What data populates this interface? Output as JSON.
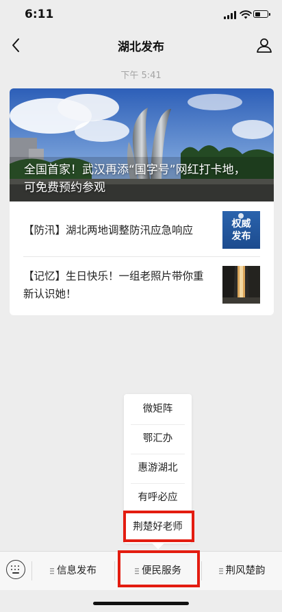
{
  "status_bar": {
    "time": "6:11",
    "battery_level": 0.35
  },
  "nav": {
    "title": "湖北发布",
    "back_icon": "chevron-left-icon",
    "profile_icon": "person-icon"
  },
  "chat": {
    "timestamp": "下午 5:41",
    "article": {
      "hero_title": "全国首家！武汉再添“国字号”网红打卡地，可免费预约参观",
      "items": [
        {
          "title": "【防汛】湖北两地调整防汛应急响应",
          "thumb_text_line1": "权威",
          "thumb_text_line2": "发布"
        },
        {
          "title": "【记忆】生日快乐！一组老照片带你重新认识她！"
        }
      ]
    }
  },
  "popup_menu": {
    "items": [
      "微矩阵",
      "鄂汇办",
      "惠游湖北",
      "有呼必应",
      "荆楚好老师"
    ]
  },
  "bottom_menu": {
    "keyboard_icon": "keyboard-icon",
    "tabs": [
      "信息发布",
      "便民服务",
      "荆风楚韵"
    ]
  },
  "colors": {
    "highlight": "#e31c10",
    "background": "#ededed"
  }
}
